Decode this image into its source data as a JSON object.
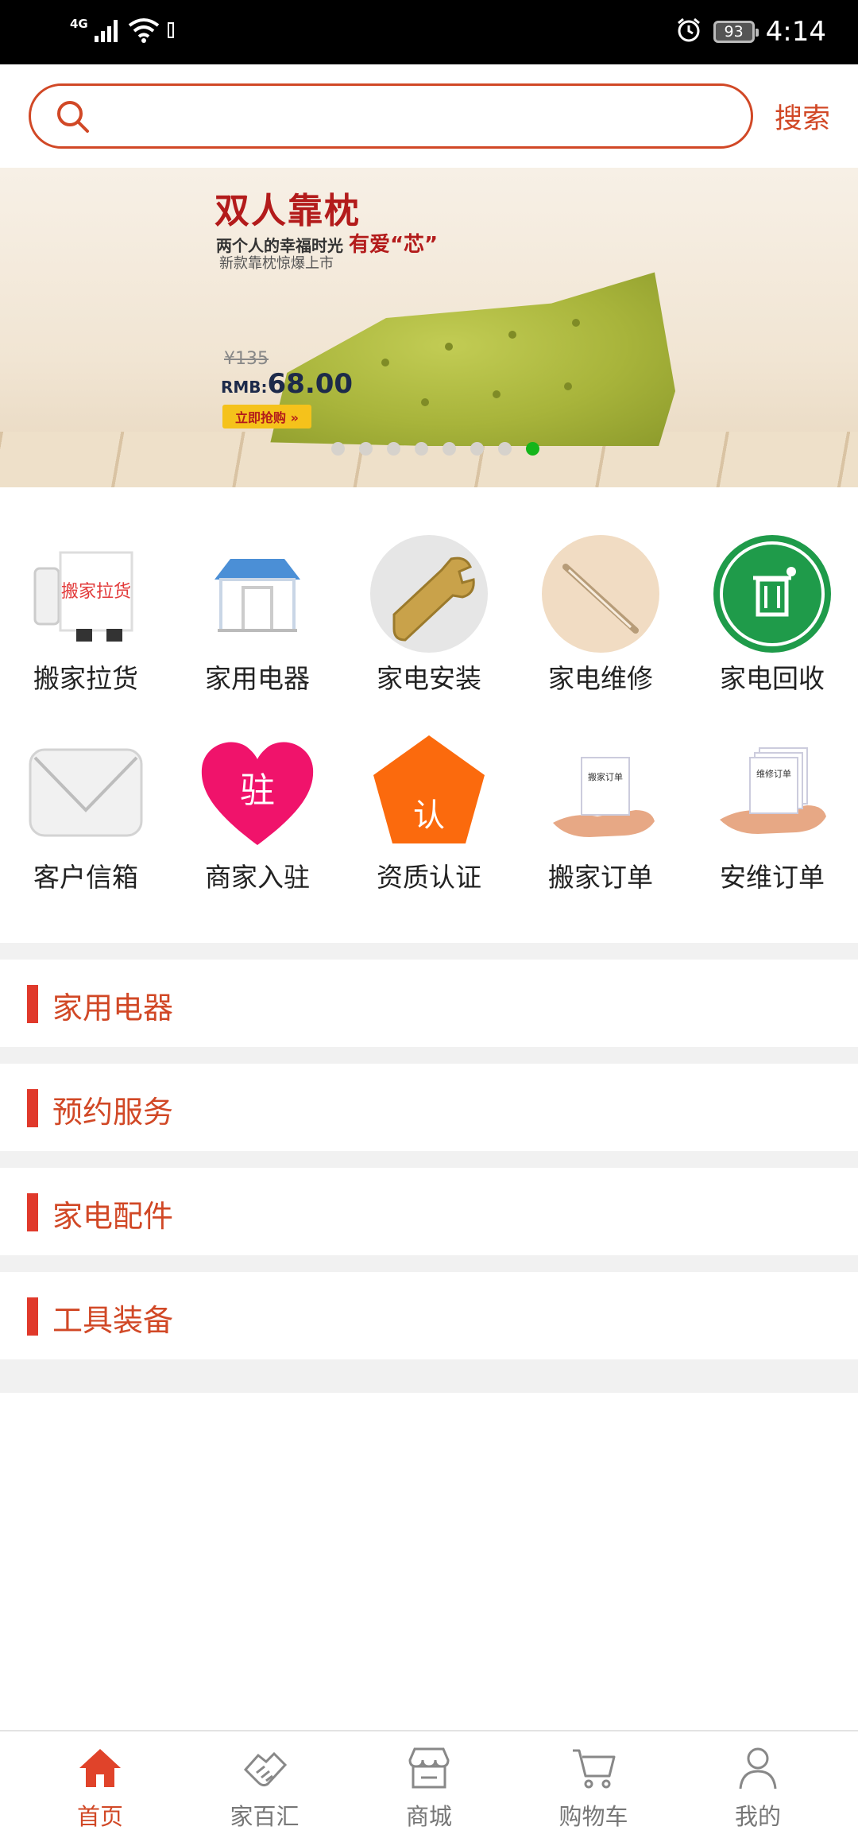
{
  "status_bar": {
    "network": "4G",
    "battery": "93",
    "time": "4:14"
  },
  "search": {
    "placeholder": "",
    "button_label": "搜索"
  },
  "banner": {
    "title": "双人靠枕",
    "subtitle_a": "两个人的幸福时光 ",
    "subtitle_b": "有爱“芯”",
    "note": "新款靠枕惊爆上市",
    "price_old": "¥135",
    "price_currency": "RMB:",
    "price_new": "68.00",
    "buy_label": "立即抢购 »",
    "dot_count": 8,
    "active_dot": 7
  },
  "categories_row1": [
    {
      "label": "搬家拉货",
      "icon": "moving-truck-icon"
    },
    {
      "label": "家用电器",
      "icon": "shop-awning-icon"
    },
    {
      "label": "家电安装",
      "icon": "wrench-icon"
    },
    {
      "label": "家电维修",
      "icon": "repair-tool-icon"
    },
    {
      "label": "家电回收",
      "icon": "recycle-bin-icon"
    }
  ],
  "categories_row2": [
    {
      "label": "客户信箱",
      "icon": "envelope-icon"
    },
    {
      "label": "商家入驻",
      "icon": "heart-badge-icon",
      "badge": "驻"
    },
    {
      "label": "资质认证",
      "icon": "pentagon-badge-icon",
      "badge": "认"
    },
    {
      "label": "搬家订单",
      "icon": "hand-card-icon",
      "card": "搬家订单"
    },
    {
      "label": "安维订单",
      "icon": "hand-cards-icon",
      "card": "维修订单"
    }
  ],
  "truck_sign": "搬家拉货",
  "sections": [
    {
      "title": "家用电器"
    },
    {
      "title": "预约服务"
    },
    {
      "title": "家电配件"
    },
    {
      "title": "工具装备"
    }
  ],
  "bottom_nav": [
    {
      "label": "首页",
      "icon": "home-icon",
      "active": true
    },
    {
      "label": "家百汇",
      "icon": "handshake-icon",
      "active": false
    },
    {
      "label": "商城",
      "icon": "store-icon",
      "active": false
    },
    {
      "label": "购物车",
      "icon": "cart-icon",
      "active": false
    },
    {
      "label": "我的",
      "icon": "user-icon",
      "active": false
    }
  ],
  "colors": {
    "accent": "#d14826",
    "section_bar": "#e0392b",
    "active_dot": "#15b51a",
    "separator": "#f1f1f1"
  }
}
